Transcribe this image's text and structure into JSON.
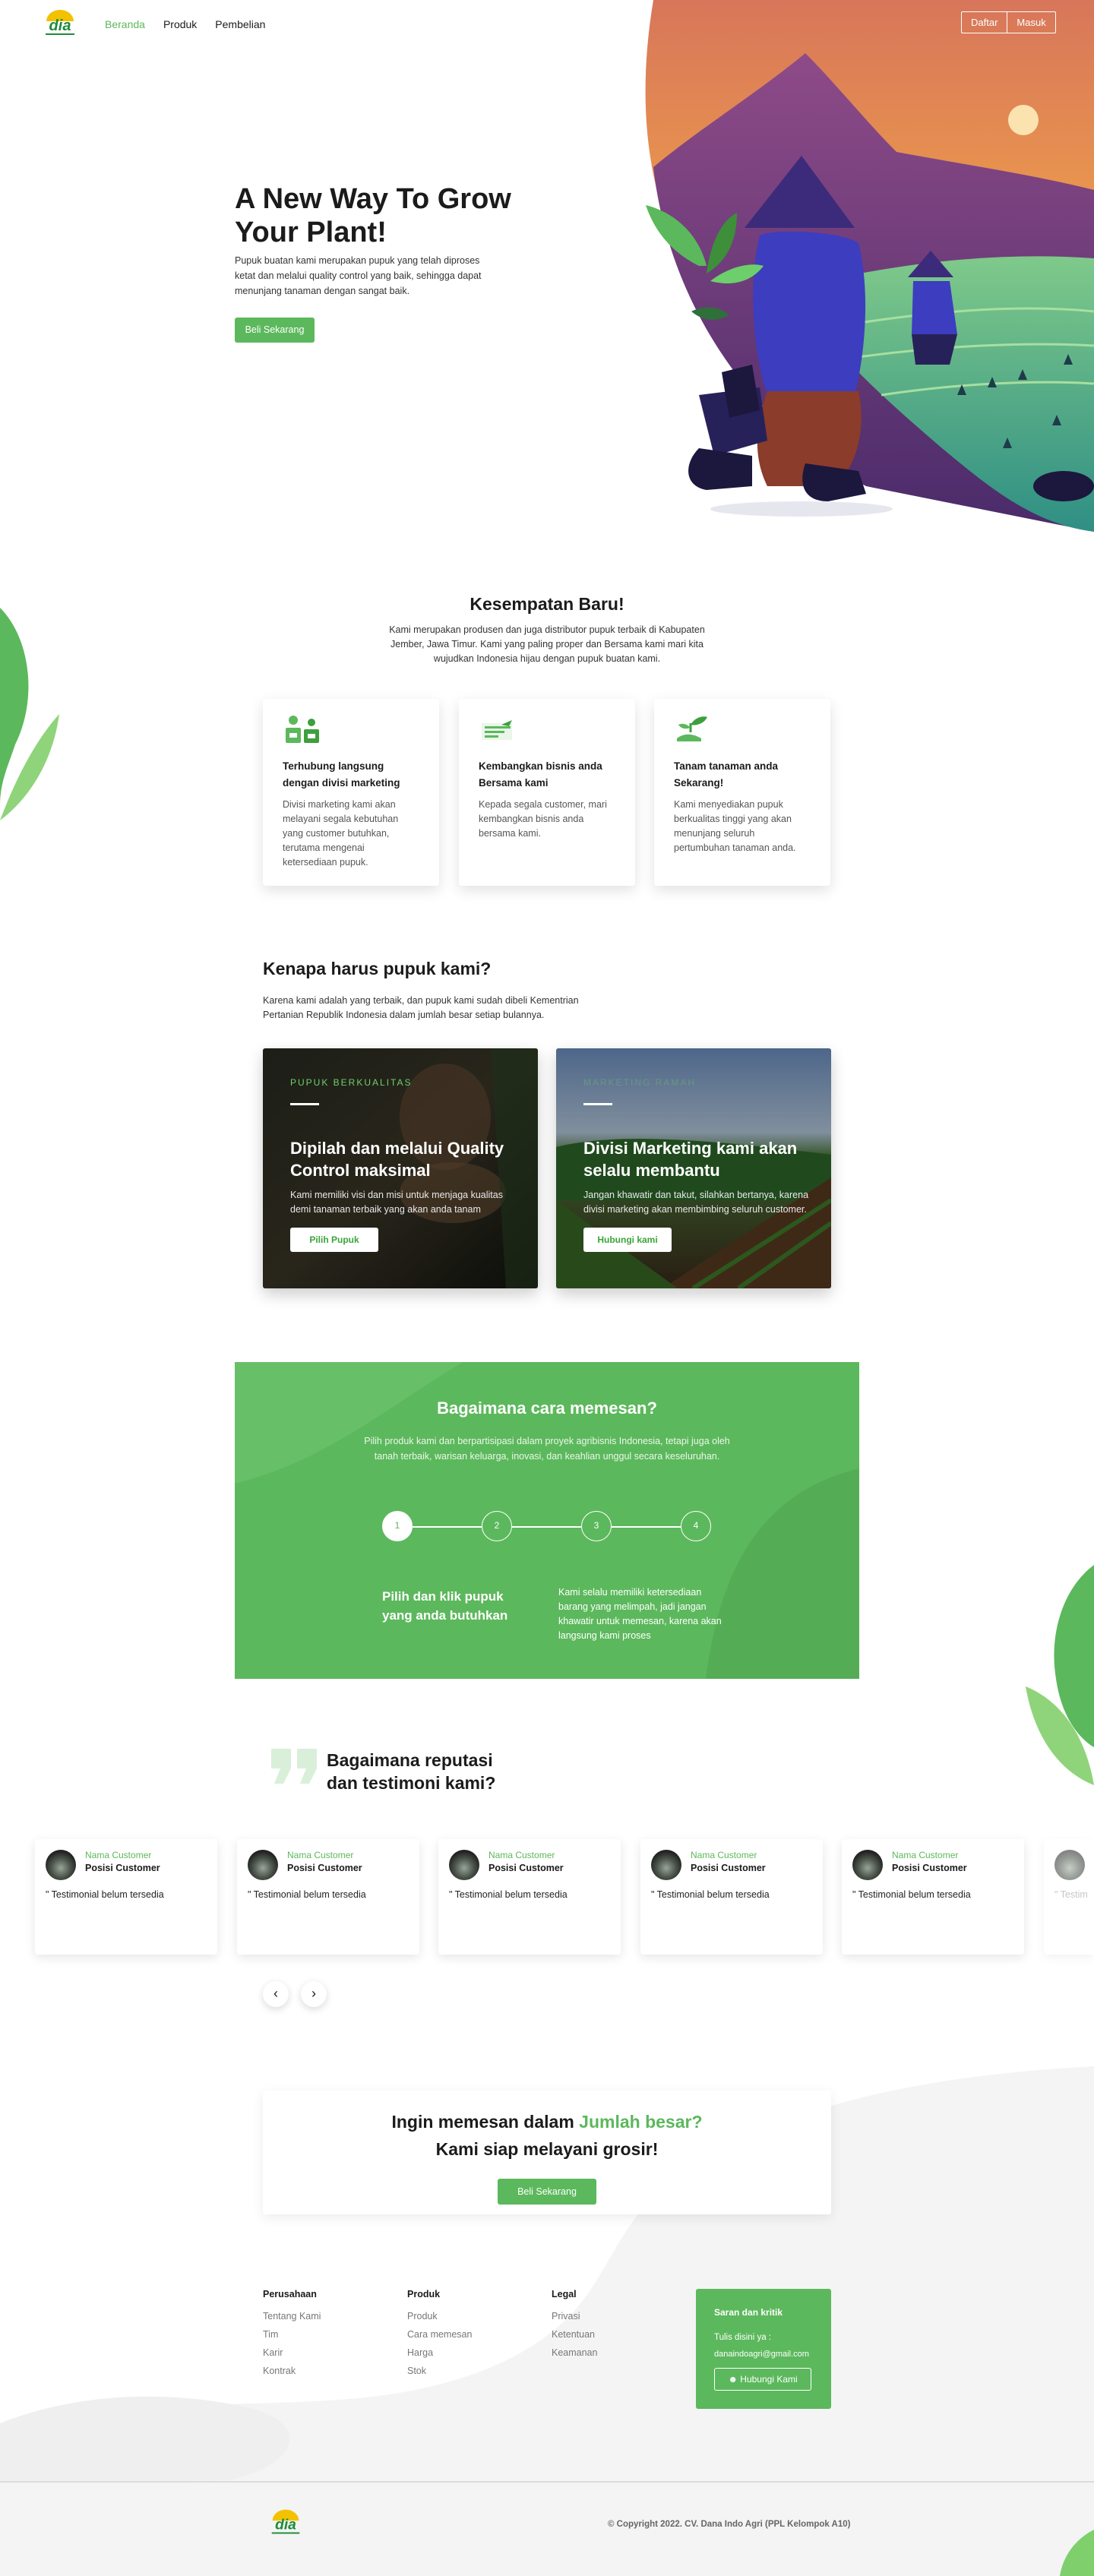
{
  "nav": {
    "links": [
      "Beranda",
      "Produk",
      "Pembelian"
    ],
    "register": "Daftar",
    "login": "Masuk"
  },
  "brand": {
    "logo_text": "dia",
    "accent": "#5cb85c"
  },
  "hero": {
    "title": "A New Way To Grow Your Plant!",
    "description": "Pupuk buatan kami merupakan pupuk yang telah diproses ketat dan melalui quality control yang baik, sehingga dapat menunjang tanaman dengan sangat baik.",
    "cta": "Beli Sekarang"
  },
  "opportunity": {
    "title": "Kesempatan Baru!",
    "description": "Kami merupakan produsen dan juga distributor pupuk terbaik di Kabupaten Jember, Jawa Timur. Kami yang paling proper dan Bersama kami mari kita wujudkan Indonesia hijau dengan pupuk buatan kami.",
    "cards": [
      {
        "icon": "farmer-icon",
        "title": "Terhubung langsung dengan divisi marketing",
        "text": "Divisi marketing kami akan melayani segala kebutuhan yang customer butuhkan, terutama mengenai ketersediaan pupuk."
      },
      {
        "icon": "business-growth-icon",
        "title": "Kembangkan bisnis anda Bersama kami",
        "text": "Kepada segala customer, mari kembangkan bisnis anda bersama kami."
      },
      {
        "icon": "plant-hand-icon",
        "title": "Tanam tanaman anda Sekarang!",
        "text": "Kami menyediakan pupuk berkualitas tinggi yang akan menunjang seluruh pertumbuhan tanaman anda."
      }
    ]
  },
  "why": {
    "title": "Kenapa harus pupuk kami?",
    "description": "Karena kami adalah yang terbaik, dan pupuk kami sudah dibeli Kementrian Pertanian Republik Indonesia dalam jumlah besar setiap bulannya.",
    "cards": [
      {
        "kicker": "PUPUK BERKUALITAS",
        "title": "Dipilah dan melalui Quality Control maksimal",
        "text": "Kami memiliki visi dan misi untuk menjaga kualitas demi tanaman terbaik yang akan anda tanam",
        "button": "Pilih Pupuk"
      },
      {
        "kicker": "MARKETING RAMAH",
        "title": "Divisi Marketing kami akan selalu membantu",
        "text": "Jangan khawatir dan takut, silahkan bertanya, karena divisi marketing akan membimbing seluruh customer.",
        "button": "Hubungi kami"
      }
    ]
  },
  "how": {
    "title": "Bagaimana cara memesan?",
    "description": "Pilih produk kami dan berpartisipasi dalam proyek agribisnis Indonesia, tetapi juga oleh tanah terbaik, warisan keluarga, inovasi, dan keahlian unggul secara keseluruhan.",
    "steps": [
      "1",
      "2",
      "3",
      "4"
    ],
    "active_step": 1,
    "step_title": "Pilih dan klik pupuk yang anda butuhkan",
    "step_text": "Kami selalu memiliki ketersediaan barang yang melimpah, jadi jangan khawatir untuk memesan, karena akan langsung kami proses"
  },
  "testimonials": {
    "title": "Bagaimana reputasi dan testimoni kami?",
    "items": [
      {
        "name": "Nama Customer",
        "position": "Posisi Customer",
        "text": "\" Testimonial belum tersedia"
      },
      {
        "name": "Nama Customer",
        "position": "Posisi Customer",
        "text": "\" Testimonial belum tersedia"
      },
      {
        "name": "Nama Customer",
        "position": "Posisi Customer",
        "text": "\" Testimonial belum tersedia"
      },
      {
        "name": "Nama Customer",
        "position": "Posisi Customer",
        "text": "\" Testimonial belum tersedia"
      },
      {
        "name": "Nama Customer",
        "position": "Posisi Customer",
        "text": "\" Testimonial belum tersedia"
      },
      {
        "name": "",
        "position": "",
        "text": "\" Testim"
      }
    ],
    "prev": "‹",
    "next": "›"
  },
  "wholesale": {
    "line1_prefix": "Ingin memesan dalam",
    "line1_highlight": "Jumlah besar?",
    "line2": "Kami siap melayani grosir!",
    "cta": "Beli Sekarang"
  },
  "footer": {
    "columns": [
      {
        "heading": "Perusahaan",
        "items": [
          "Tentang Kami",
          "Tim",
          "Karir",
          "Kontrak"
        ]
      },
      {
        "heading": "Produk",
        "items": [
          "Produk",
          "Cara memesan",
          "Harga",
          "Stok"
        ]
      },
      {
        "heading": "Legal",
        "items": [
          "Privasi",
          "Ketentuan",
          "Keamanan"
        ]
      }
    ],
    "feedback": {
      "title": "Saran dan kritik",
      "subtitle": "Tulis disini ya :",
      "email": "danaindoagri@gmail.com",
      "button": "Hubungi Kami"
    },
    "copyright": "© Copyright 2022. CV. Dana Indo Agri (PPL Kelompok A10)"
  }
}
